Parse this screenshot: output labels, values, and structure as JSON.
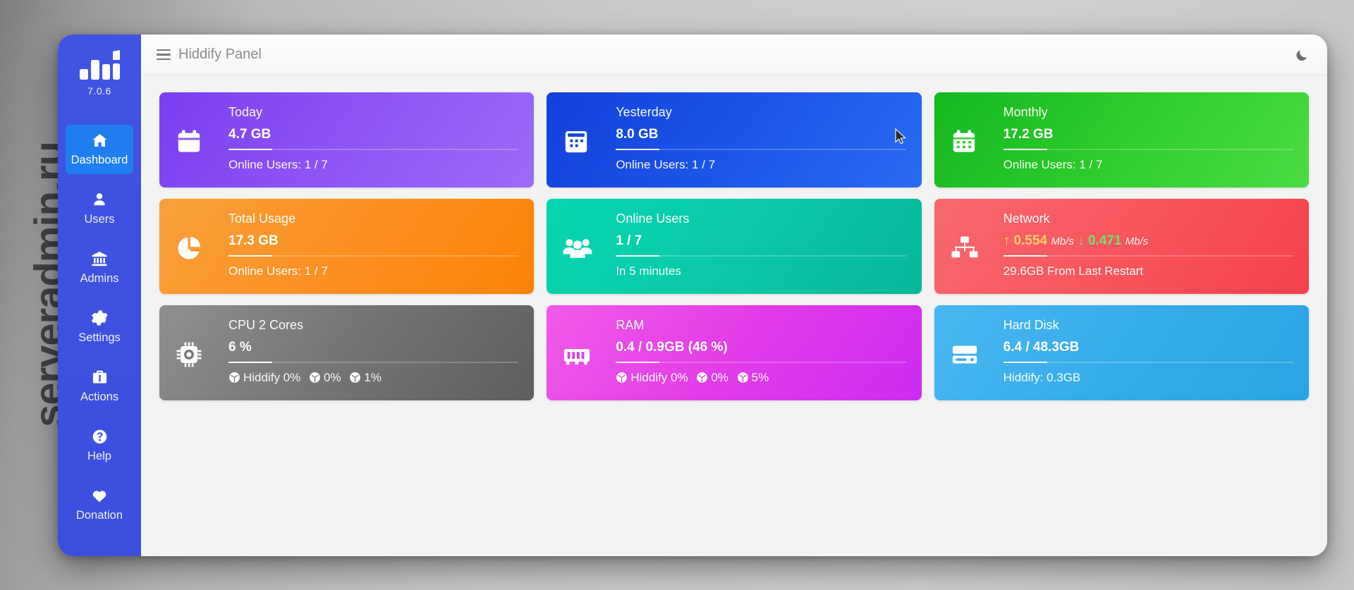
{
  "watermark": "serveradmin.ru",
  "sidebar": {
    "logo_icon": "bar-chart-logo-icon",
    "version": "7.0.6",
    "items": [
      {
        "label": "Dashboard",
        "icon": "home-icon",
        "active": true
      },
      {
        "label": "Users",
        "icon": "user-icon",
        "active": false
      },
      {
        "label": "Admins",
        "icon": "bank-icon",
        "active": false
      },
      {
        "label": "Settings",
        "icon": "gear-icon",
        "active": false
      },
      {
        "label": "Actions",
        "icon": "briefcase-icon",
        "active": false
      },
      {
        "label": "Help",
        "icon": "question-circle-icon",
        "active": false
      },
      {
        "label": "Donation",
        "icon": "heart-icon",
        "active": false
      }
    ]
  },
  "topbar": {
    "menu_icon": "hamburger-icon",
    "title": "Hiddify Panel",
    "theme_toggle_icon": "moon-icon"
  },
  "cards": [
    {
      "id": "today",
      "title": "Today",
      "icon": "calendar-icon",
      "value": "4.7 GB",
      "footer": "Online Users: 1 / 7",
      "color": "#8b53f4"
    },
    {
      "id": "yesterday",
      "title": "Yesterday",
      "icon": "calendar-day-icon",
      "value": "8.0 GB",
      "footer": "Online Users: 1 / 7",
      "color": "#1b55e8"
    },
    {
      "id": "monthly",
      "title": "Monthly",
      "icon": "calendar-month-icon",
      "value": "17.2 GB",
      "footer": "Online Users: 1 / 7",
      "color": "#2fcc2c"
    },
    {
      "id": "total-usage",
      "title": "Total Usage",
      "icon": "pie-chart-icon",
      "value": "17.3 GB",
      "footer": "Online Users: 1 / 7",
      "color": "#fb9022"
    },
    {
      "id": "online-users",
      "title": "Online Users",
      "icon": "users-group-icon",
      "value": "1 / 7",
      "footer": "In 5 minutes",
      "color": "#0ac8a8"
    },
    {
      "id": "network",
      "title": "Network",
      "icon": "network-icon",
      "upload": "0.554",
      "upload_unit": "Mb/s",
      "download": "0.471",
      "download_unit": "Mb/s",
      "upload_arrow": "arrow-up-icon",
      "download_arrow": "arrow-down-icon",
      "footer": "29.6GB From Last Restart",
      "color": "#f8555c",
      "upload_color": "#ffcf66",
      "download_color": "#73e06a"
    },
    {
      "id": "cpu",
      "title": "CPU 2 Cores",
      "icon": "cpu-icon",
      "value": "6 %",
      "gauges": [
        "Hiddify 0%",
        "0%",
        "1%"
      ],
      "color": "#777777"
    },
    {
      "id": "ram",
      "title": "RAM",
      "icon": "memory-icon",
      "value": "0.4 / 0.9GB (46 %)",
      "gauges": [
        "Hiddify 0%",
        "0%",
        "5%"
      ],
      "color": "#e23ce8"
    },
    {
      "id": "hard-disk",
      "title": "Hard Disk",
      "icon": "hard-drive-icon",
      "value": "6.4 / 48.3GB",
      "footer": "Hiddify: 0.3GB",
      "color": "#35ace9"
    }
  ],
  "cursor": {
    "icon": "mouse-pointer-icon"
  }
}
